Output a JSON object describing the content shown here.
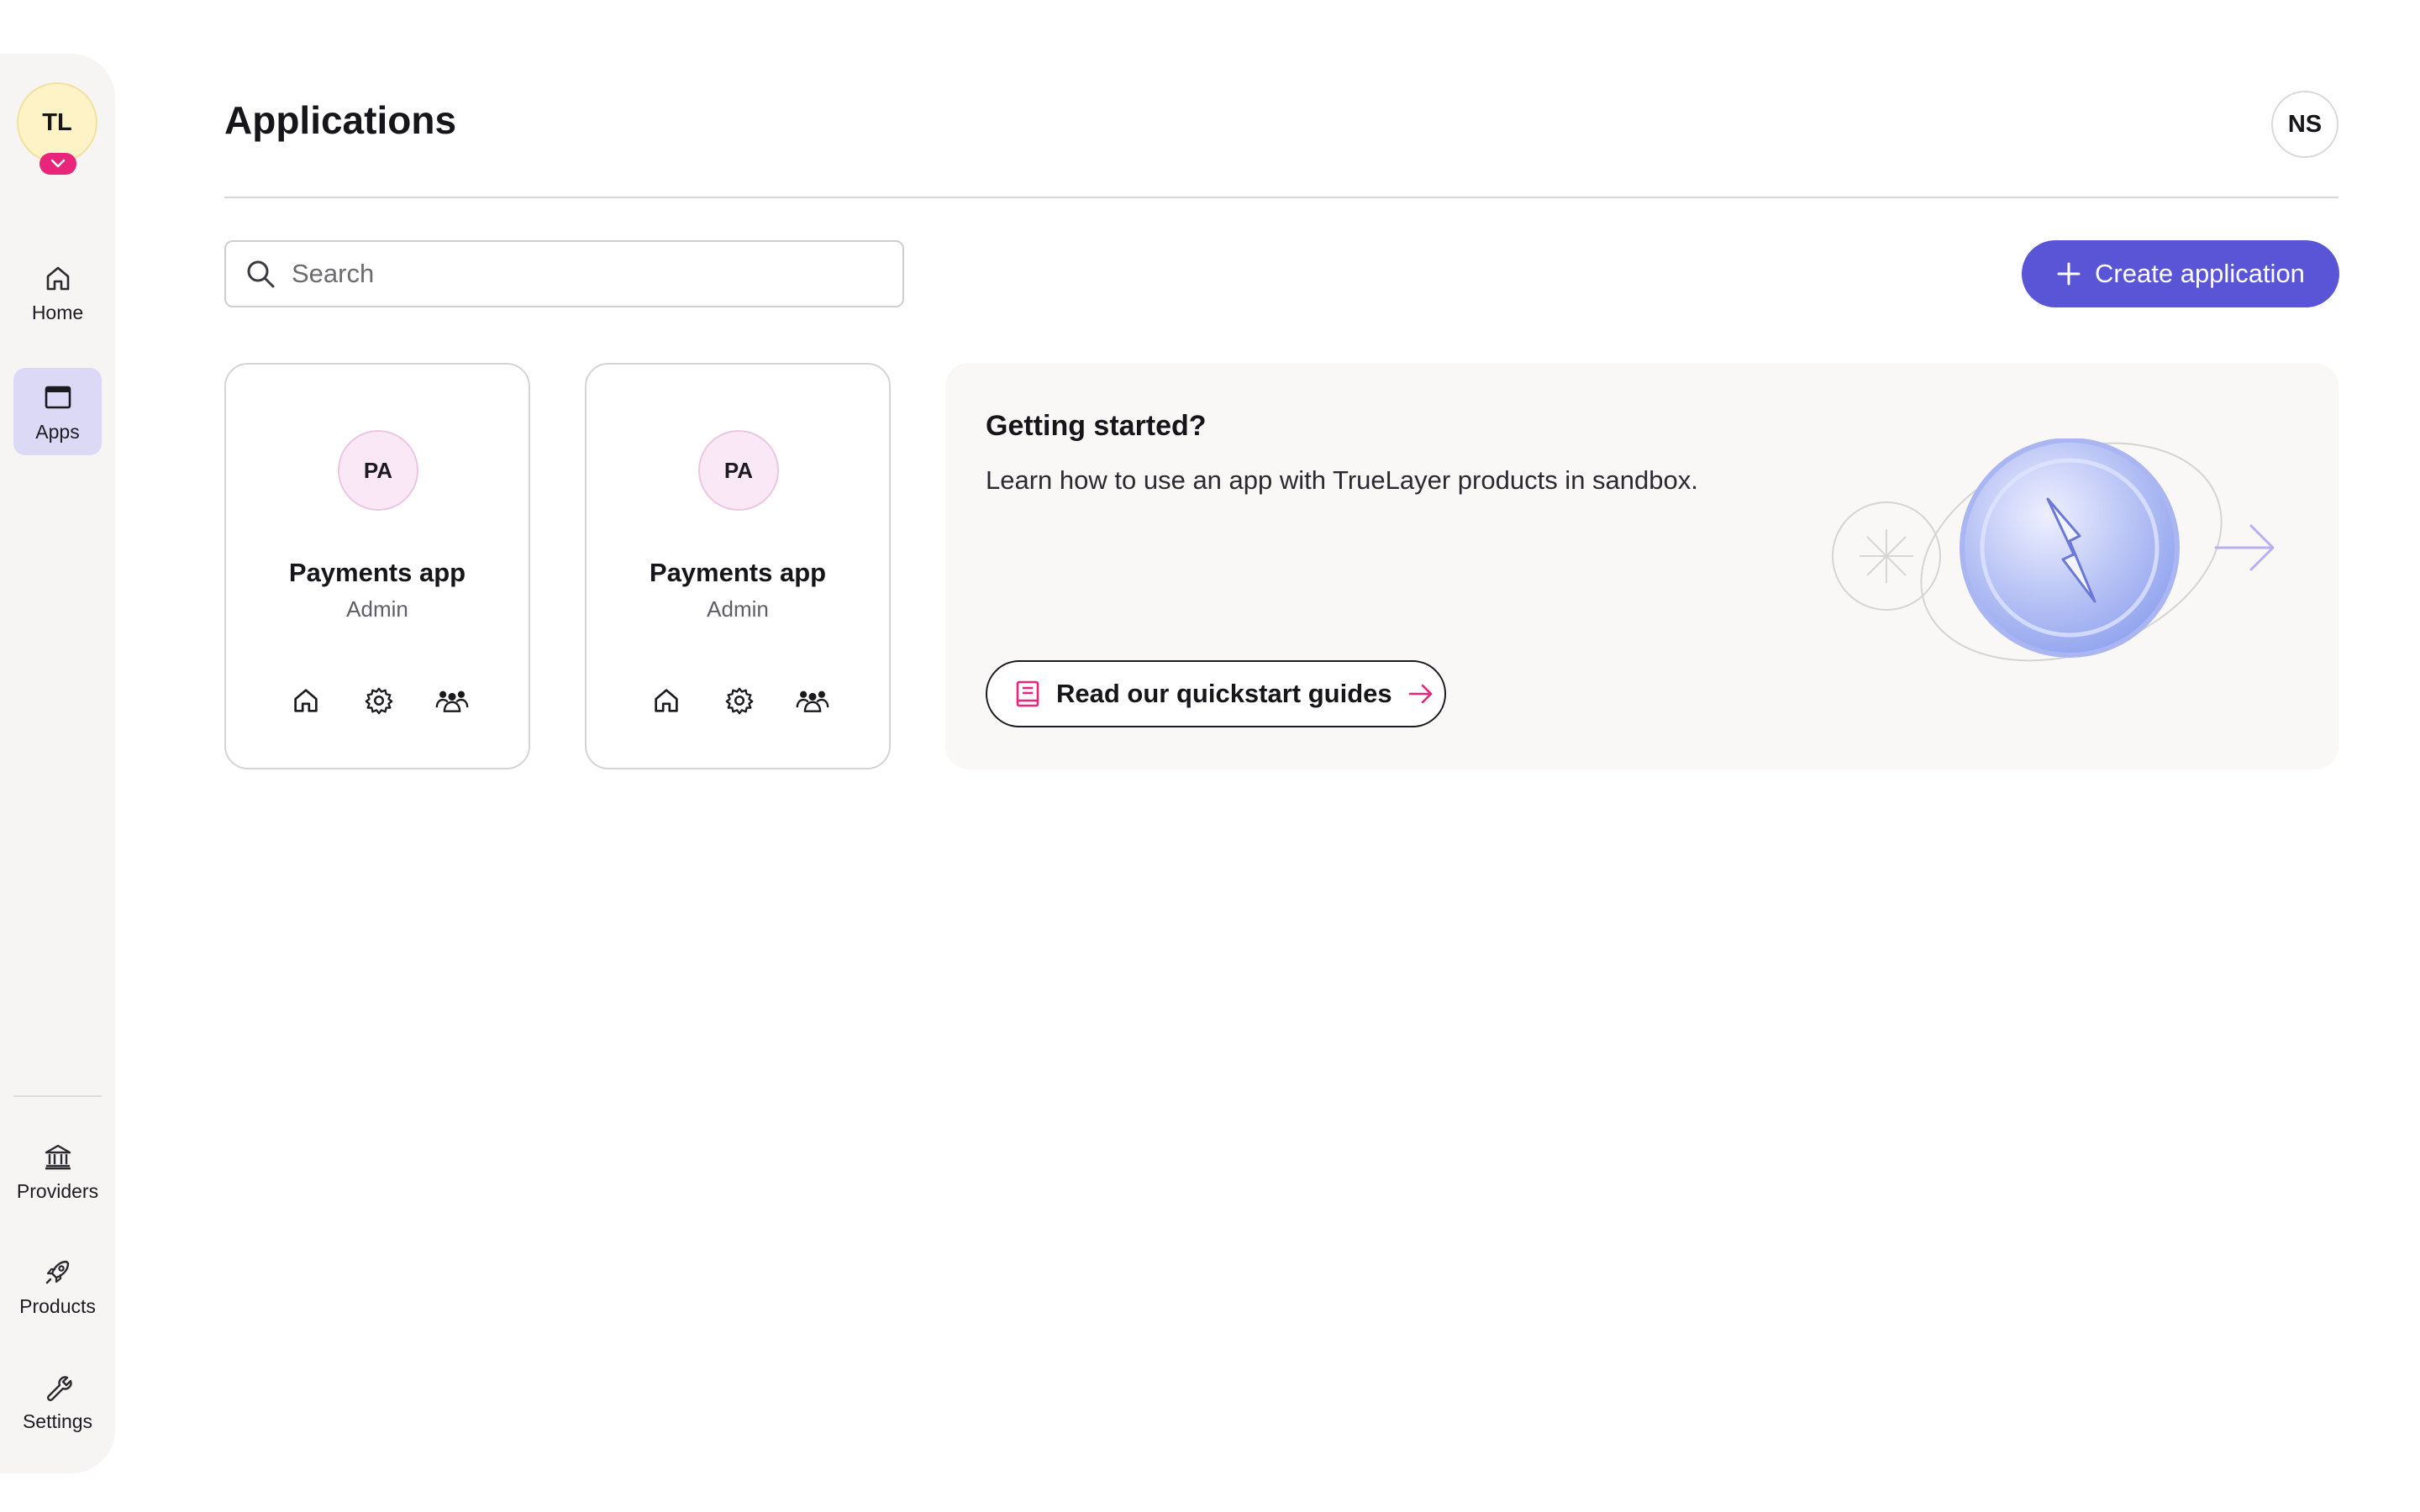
{
  "sidebar": {
    "org_initials": "TL",
    "nav_top": [
      {
        "label": "Home",
        "icon": "home-icon"
      },
      {
        "label": "Apps",
        "icon": "window-icon",
        "active": true
      }
    ],
    "nav_bottom": [
      {
        "label": "Providers",
        "icon": "bank-icon"
      },
      {
        "label": "Products",
        "icon": "rocket-icon"
      },
      {
        "label": "Settings",
        "icon": "wrench-icon"
      }
    ]
  },
  "header": {
    "title": "Applications",
    "user_initials": "NS"
  },
  "toolbar": {
    "search_placeholder": "Search",
    "create_label": "Create application"
  },
  "apps": [
    {
      "initials": "PA",
      "name": "Payments app",
      "role": "Admin"
    },
    {
      "initials": "PA",
      "name": "Payments app",
      "role": "Admin"
    }
  ],
  "getting_started": {
    "title": "Getting started?",
    "description": "Learn how to use an app with TrueLayer products in sandbox.",
    "link_label": "Read our quickstart guides"
  },
  "colors": {
    "accent": "#5a55d6",
    "brand_pink": "#e8247b",
    "active_nav_bg": "#dcd9f7",
    "org_avatar_bg": "#fdf3c6",
    "app_avatar_bg": "#fbe8f6"
  }
}
